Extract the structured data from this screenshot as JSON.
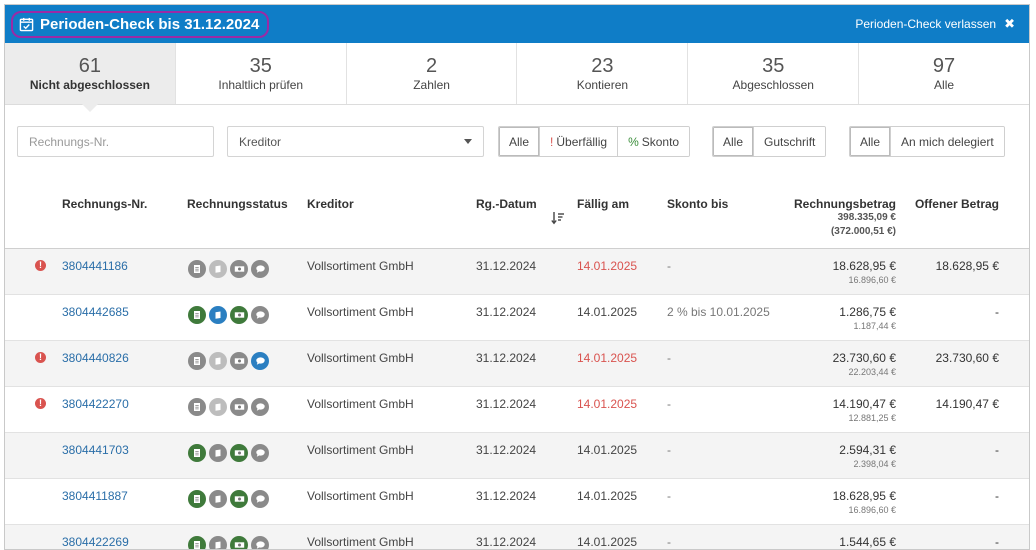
{
  "header": {
    "title": "Perioden-Check bis 31.12.2024",
    "leave_label": "Perioden-Check verlassen",
    "close_glyph": "✖"
  },
  "tabs": [
    {
      "count": "61",
      "label": "Nicht abgeschlossen",
      "active": true
    },
    {
      "count": "35",
      "label": "Inhaltlich prüfen"
    },
    {
      "count": "2",
      "label": "Zahlen"
    },
    {
      "count": "23",
      "label": "Kontieren"
    },
    {
      "count": "35",
      "label": "Abgeschlossen"
    },
    {
      "count": "97",
      "label": "Alle"
    }
  ],
  "filters": {
    "invoice_placeholder": "Rechnungs-Nr.",
    "creditor_label": "Kreditor",
    "group1": {
      "all": "Alle",
      "overdue_mark": "!",
      "overdue": "Überfällig",
      "discount_mark": "%",
      "discount": "Skonto"
    },
    "group2": {
      "all": "Alle",
      "credit": "Gutschrift"
    },
    "group3": {
      "all": "Alle",
      "delegated": "An mich delegiert"
    }
  },
  "table": {
    "headers": {
      "invoice_no": "Rechnungs-Nr.",
      "status": "Rechnungsstatus",
      "creditor": "Kreditor",
      "invoice_date": "Rg.-Datum",
      "due": "Fällig am",
      "discount_until": "Skonto bis",
      "amount": "Rechnungsbetrag",
      "amount_total": "398.335,09 €",
      "amount_total_net": "(372.000,51 €)",
      "open_amount": "Offener Betrag"
    },
    "rows": [
      {
        "warn": true,
        "nr": "3804441186",
        "status": [
          "grey",
          "lgrey",
          "grey",
          "grey"
        ],
        "creditor": "Vollsortiment GmbH",
        "date": "31.12.2024",
        "due": "14.01.2025",
        "overdue": true,
        "skonto": "-",
        "amount": "18.628,95 €",
        "amount_net": "16.896,60 €",
        "open": "18.628,95 €"
      },
      {
        "warn": false,
        "nr": "3804442685",
        "status": [
          "green",
          "blue",
          "green",
          "grey"
        ],
        "creditor": "Vollsortiment GmbH",
        "date": "31.12.2024",
        "due": "14.01.2025",
        "overdue": false,
        "skonto": "2 % bis 10.01.2025",
        "amount": "1.286,75 €",
        "amount_net": "1.187,44 €",
        "open": "-"
      },
      {
        "warn": true,
        "nr": "3804440826",
        "status": [
          "grey",
          "lgrey",
          "grey",
          "blue"
        ],
        "creditor": "Vollsortiment GmbH",
        "date": "31.12.2024",
        "due": "14.01.2025",
        "overdue": true,
        "skonto": "-",
        "amount": "23.730,60 €",
        "amount_net": "22.203,44 €",
        "open": "23.730,60 €"
      },
      {
        "warn": true,
        "nr": "3804422270",
        "status": [
          "grey",
          "lgrey",
          "grey",
          "grey"
        ],
        "creditor": "Vollsortiment GmbH",
        "date": "31.12.2024",
        "due": "14.01.2025",
        "overdue": true,
        "skonto": "-",
        "amount": "14.190,47 €",
        "amount_net": "12.881,25 €",
        "open": "14.190,47 €"
      },
      {
        "warn": false,
        "nr": "3804441703",
        "status": [
          "green",
          "grey",
          "green",
          "grey"
        ],
        "creditor": "Vollsortiment GmbH",
        "date": "31.12.2024",
        "due": "14.01.2025",
        "overdue": false,
        "skonto": "-",
        "amount": "2.594,31 €",
        "amount_net": "2.398,04 €",
        "open": "-"
      },
      {
        "warn": false,
        "nr": "3804411887",
        "status": [
          "green",
          "grey",
          "green",
          "grey"
        ],
        "creditor": "Vollsortiment GmbH",
        "date": "31.12.2024",
        "due": "14.01.2025",
        "overdue": false,
        "skonto": "-",
        "amount": "18.628,95 €",
        "amount_net": "16.896,60 €",
        "open": "-"
      },
      {
        "warn": false,
        "nr": "3804422269",
        "status": [
          "green",
          "grey",
          "green",
          "grey"
        ],
        "creditor": "Vollsortiment GmbH",
        "date": "31.12.2024",
        "due": "14.01.2025",
        "overdue": false,
        "skonto": "-",
        "amount": "1.544,65 €",
        "amount_net": "",
        "open": "-"
      }
    ]
  },
  "icons": {
    "title": "calendar-check-icon",
    "sort": "sort-descending-icon",
    "warning": "exclamation-circle-icon",
    "status_icons": [
      "document-icon",
      "book-icon",
      "money-icon",
      "comment-icon"
    ]
  },
  "colors": {
    "header_bg": "#0f7dc7",
    "highlight_border": "#9b2aa6",
    "link": "#2a6ea8",
    "overdue": "#d9534f",
    "status_green": "#3f7a3b",
    "status_blue": "#2b7fc1",
    "status_grey": "#8a8a8a",
    "status_light_grey": "#bdbdbd"
  }
}
